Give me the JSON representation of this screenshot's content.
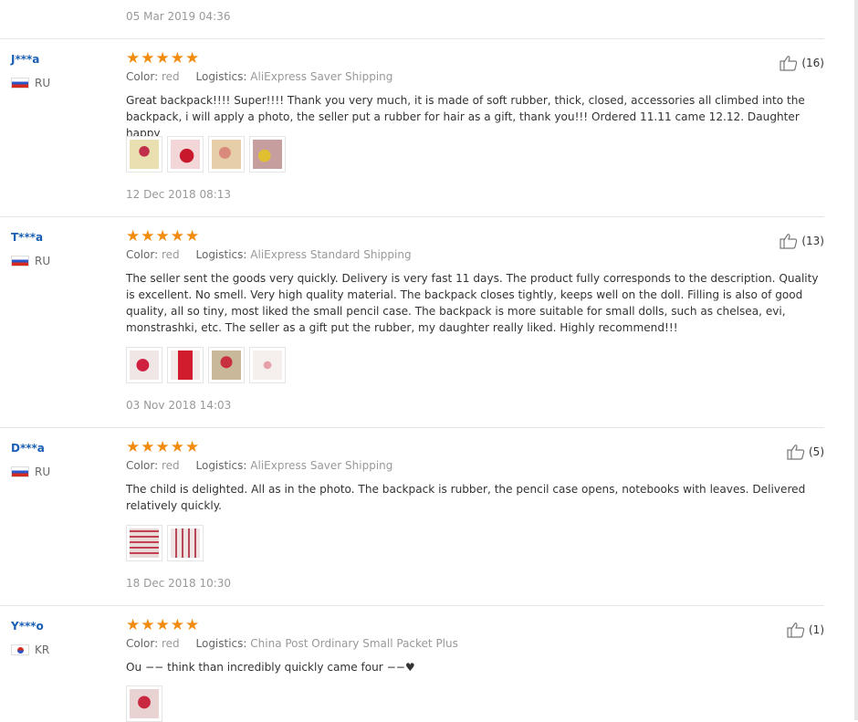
{
  "top_date": "05 Mar 2019 04:36",
  "labels": {
    "color": "Color:",
    "logistics": "Logistics:"
  },
  "reviews": [
    {
      "user": "J***a",
      "country": "RU",
      "stars": 5,
      "color": "red",
      "logistics": "AliExpress Saver Shipping",
      "helpful": "(16)",
      "text": "Great backpack!!!! Super!!!! Thank you very much, it is made of soft rubber, thick, closed, accessories all climbed into the backpack, i will apply a photo, the seller put a rubber for hair as a gift, thank you!!! Ordered 11.11 came 12.12. Daughter happy",
      "photo_count": 4,
      "date": "12 Dec 2018 08:13"
    },
    {
      "user": "T***a",
      "country": "RU",
      "stars": 5,
      "color": "red",
      "logistics": "AliExpress Standard Shipping",
      "helpful": "(13)",
      "text": "The seller sent the goods very quickly. Delivery is very fast 11 days. The product fully corresponds to the description. Quality is excellent. No smell. Very high quality material. The backpack closes tightly, keeps well on the doll. Filling is also of good quality, all so tiny, most liked the small pencil case. The backpack is more suitable for small dolls, such as chelsea, evi, monstrashki, etc. The seller as a gift put the rubber, my daughter really liked. Highly recommend!!!",
      "photo_count": 4,
      "date": "03 Nov 2018 14:03"
    },
    {
      "user": "D***a",
      "country": "RU",
      "stars": 5,
      "color": "red",
      "logistics": "AliExpress Saver Shipping",
      "helpful": "(5)",
      "text": "The child is delighted. All as in the photo. The backpack is rubber, the pencil case opens, notebooks with leaves. Delivered relatively quickly.",
      "photo_count": 2,
      "date": "18 Dec 2018 10:30"
    },
    {
      "user": "Y***o",
      "country": "KR",
      "stars": 5,
      "color": "red",
      "logistics": "China Post Ordinary Small Packet Plus",
      "helpful": "(1)",
      "text": "Ou −− think than incredibly quickly came four −−♥",
      "photo_count": 1,
      "date": ""
    }
  ]
}
